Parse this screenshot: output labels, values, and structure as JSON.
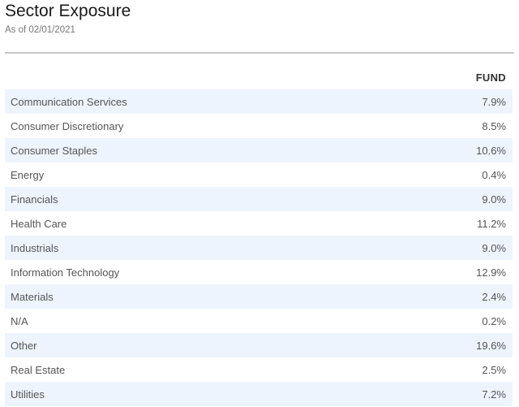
{
  "header": {
    "title": "Sector Exposure",
    "as_of": "As of 02/01/2021"
  },
  "table": {
    "column": "FUND",
    "rows": [
      {
        "sector": "Communication Services",
        "fund": "7.9%"
      },
      {
        "sector": "Consumer Discretionary",
        "fund": "8.5%"
      },
      {
        "sector": "Consumer Staples",
        "fund": "10.6%"
      },
      {
        "sector": "Energy",
        "fund": "0.4%"
      },
      {
        "sector": "Financials",
        "fund": "9.0%"
      },
      {
        "sector": "Health Care",
        "fund": "11.2%"
      },
      {
        "sector": "Industrials",
        "fund": "9.0%"
      },
      {
        "sector": "Information Technology",
        "fund": "12.9%"
      },
      {
        "sector": "Materials",
        "fund": "2.4%"
      },
      {
        "sector": "N/A",
        "fund": "0.2%"
      },
      {
        "sector": "Other",
        "fund": "19.6%"
      },
      {
        "sector": "Real Estate",
        "fund": "2.5%"
      },
      {
        "sector": "Utilities",
        "fund": "7.2%"
      }
    ]
  }
}
